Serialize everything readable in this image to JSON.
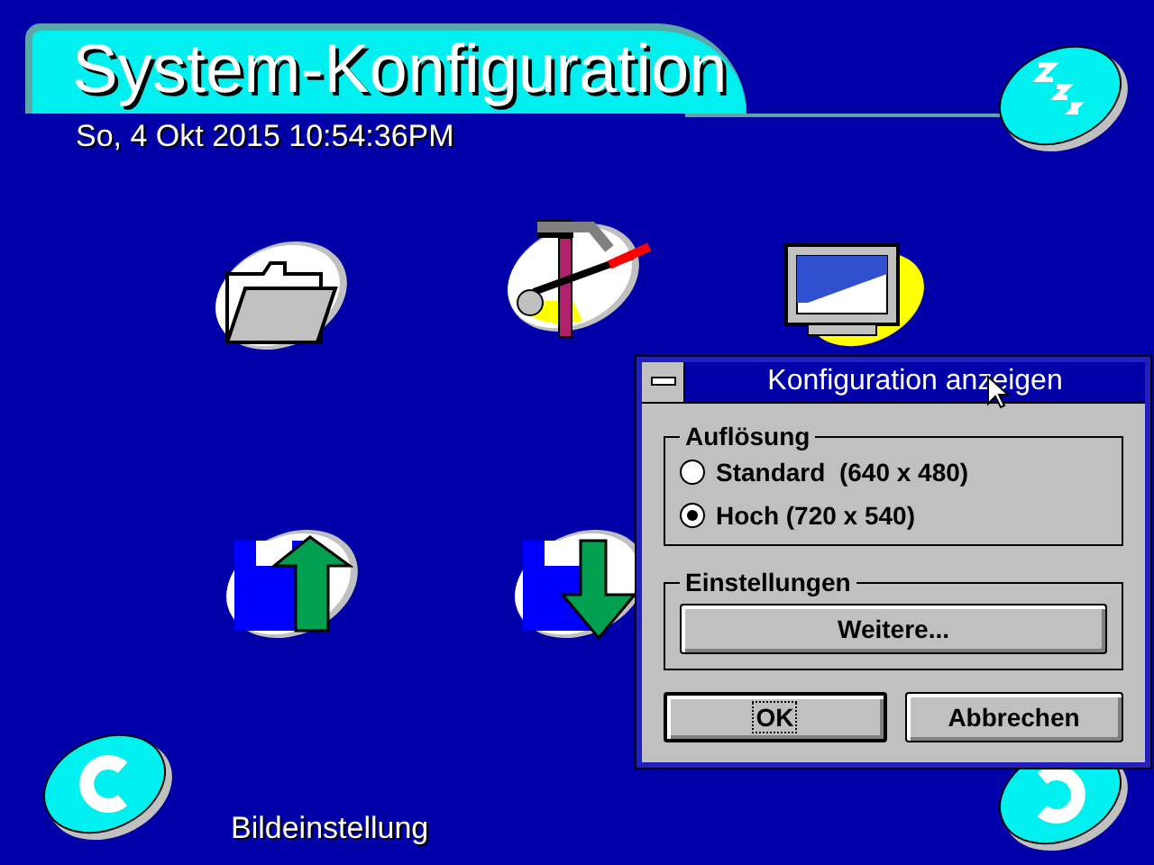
{
  "header": {
    "title": "System-Konfiguration",
    "datetime": "So, 4 Okt 2015 10:54:36PM"
  },
  "dialog": {
    "title": "Konfiguration anzeigen",
    "resolution": {
      "label": "Auflösung",
      "options": [
        {
          "label": "Standard  (640 x 480)",
          "selected": false
        },
        {
          "label": "Hoch (720 x 540)",
          "selected": true
        }
      ]
    },
    "settings": {
      "label": "Einstellungen",
      "button": "Weitere..."
    },
    "buttons": [
      {
        "label": "OK",
        "focused": true
      },
      {
        "label": "Abbrechen",
        "focused": false
      }
    ]
  },
  "caption": "Bildeinstellung"
}
